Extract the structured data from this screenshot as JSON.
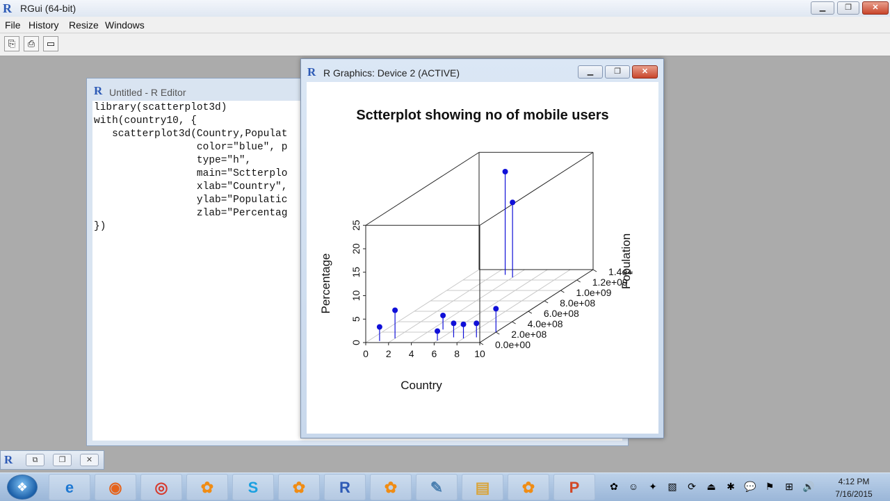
{
  "rgui": {
    "logo": "R",
    "title": "RGui (64-bit)",
    "window_controls": {
      "minimize": "▁",
      "restore": "❐",
      "close": "✕"
    }
  },
  "menu": {
    "items": [
      "File",
      "History",
      "Resize",
      "Windows"
    ]
  },
  "toolbar": {
    "buttons": [
      {
        "icon": "copy-icon",
        "glyph": "⎘"
      },
      {
        "icon": "print-icon",
        "glyph": "⎙"
      },
      {
        "icon": "window-icon",
        "glyph": "▭"
      }
    ]
  },
  "editor": {
    "logo": "R",
    "title": "Untitled - R Editor",
    "code": "library(scatterplot3d)\nwith(country10, {\n   scatterplot3d(Country,Populat\n                 color=\"blue\", p\n                 type=\"h\",\n                 main=\"Sctterplo\n                 xlab=\"Country\",\n                 ylab=\"Populatic\n                 zlab=\"Percentag\n})"
  },
  "graphics": {
    "logo": "R",
    "title": "R Graphics: Device 2 (ACTIVE)",
    "window_controls": {
      "minimize": "▁",
      "restore": "❐",
      "close": "✕"
    }
  },
  "chart_data": {
    "type": "scatter",
    "title": "Sctterplot showing no of mobile users",
    "xlabel": "Country",
    "ylabel": "Population",
    "zlabel": "Percentage",
    "x_ticks": [
      "0",
      "2",
      "4",
      "6",
      "8",
      "10"
    ],
    "y_ticks": [
      "0.0e+00",
      "2.0e+08",
      "4.0e+08",
      "6.0e+08",
      "8.0e+08",
      "1.0e+09",
      "1.2e+09",
      "1.4e+"
    ],
    "z_ticks": [
      "0",
      "5",
      "10",
      "15",
      "20",
      "25"
    ],
    "xlim": [
      0,
      10
    ],
    "ylim": [
      0,
      1400000000
    ],
    "zlim": [
      0,
      25
    ],
    "point_color": "#1010d8",
    "points": [
      {
        "x": 1,
        "y": 30000000,
        "z": 3
      },
      {
        "x": 2,
        "y": 80000000,
        "z": 6
      },
      {
        "x": 3,
        "y": 1300000000,
        "z": 22
      },
      {
        "x": 4,
        "y": 1250000000,
        "z": 16
      },
      {
        "x": 5,
        "y": 250000000,
        "z": 3
      },
      {
        "x": 6,
        "y": 40000000,
        "z": 2
      },
      {
        "x": 7,
        "y": 100000000,
        "z": 3
      },
      {
        "x": 8,
        "y": 80000000,
        "z": 3
      },
      {
        "x": 9,
        "y": 100000000,
        "z": 3
      },
      {
        "x": 10,
        "y": 200000000,
        "z": 5
      }
    ]
  },
  "minimized_window": {
    "logo": "R",
    "controls": [
      "⧉",
      "❐",
      "✕"
    ]
  },
  "taskbar": {
    "start_glyph": "❖",
    "apps": [
      {
        "icon": "internet-explorer-icon",
        "glyph": "e",
        "color": "#1e78d2"
      },
      {
        "icon": "firefox-icon",
        "glyph": "◉",
        "color": "#e5631c"
      },
      {
        "icon": "chrome-icon",
        "glyph": "◎",
        "color": "#d63b2f"
      },
      {
        "icon": "flower-app-icon",
        "glyph": "✿",
        "color": "#f08c14"
      },
      {
        "icon": "skype-icon",
        "glyph": "S",
        "color": "#1aa0e0"
      },
      {
        "icon": "flower-app-icon",
        "glyph": "✿",
        "color": "#f08c14"
      },
      {
        "icon": "r-icon",
        "glyph": "R",
        "color": "#2d5ab5"
      },
      {
        "icon": "flower-app-icon",
        "glyph": "✿",
        "color": "#f08c14"
      },
      {
        "icon": "notepad-icon",
        "glyph": "✎",
        "color": "#4a7fb0"
      },
      {
        "icon": "folder-icon",
        "glyph": "▤",
        "color": "#d9a43a"
      },
      {
        "icon": "flower-app-icon",
        "glyph": "✿",
        "color": "#f08c14"
      },
      {
        "icon": "powerpoint-icon",
        "glyph": "P",
        "color": "#d24726"
      }
    ],
    "tray": [
      {
        "icon": "flower-tray-icon",
        "glyph": "✿"
      },
      {
        "icon": "smiley-tray-icon",
        "glyph": "☺"
      },
      {
        "icon": "app-tray-icon",
        "glyph": "✦"
      },
      {
        "icon": "document-tray-icon",
        "glyph": "▧"
      },
      {
        "icon": "refresh-tray-icon",
        "glyph": "⟳"
      },
      {
        "icon": "usb-tray-icon",
        "glyph": "⏏"
      },
      {
        "icon": "app-tray-icon",
        "glyph": "✱"
      },
      {
        "icon": "chat-tray-icon",
        "glyph": "💬"
      },
      {
        "icon": "flag-tray-icon",
        "glyph": "⚑"
      },
      {
        "icon": "network-tray-icon",
        "glyph": "⊞"
      },
      {
        "icon": "volume-tray-icon",
        "glyph": "🔊"
      }
    ],
    "clock_time": "4:12 PM",
    "clock_date": "7/16/2015"
  }
}
